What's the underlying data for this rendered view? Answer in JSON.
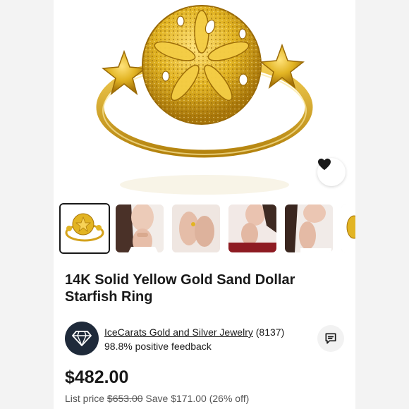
{
  "product": {
    "title": "14K Solid Yellow Gold Sand Dollar Starfish Ring",
    "price": "$482.00",
    "list_price_label": "List price",
    "list_price": "$653.00",
    "savings": "Save $171.00 (26% off)"
  },
  "seller": {
    "name": "IceCarats Gold and Silver Jewelry",
    "rating_count": "(8137)",
    "feedback": "98.8% positive feedback",
    "logo_icon": "diamond-icon"
  },
  "gallery": {
    "thumbnails": [
      {
        "subject": "ring"
      },
      {
        "subject": "model"
      },
      {
        "subject": "hands"
      },
      {
        "subject": "model"
      },
      {
        "subject": "model"
      },
      {
        "subject": "ring"
      }
    ],
    "selected_index": 0
  },
  "icons": {
    "favorite": "heart-icon",
    "message": "message-icon"
  },
  "colors": {
    "gold": "#e2b423",
    "gold_dark": "#b07d07",
    "text": "#191919",
    "seller_logo_bg": "#1f2a3a"
  }
}
